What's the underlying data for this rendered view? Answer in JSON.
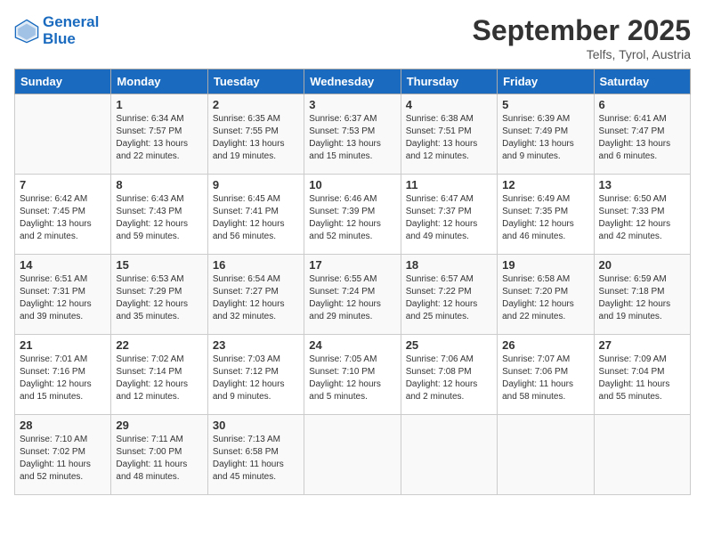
{
  "header": {
    "logo_line1": "General",
    "logo_line2": "Blue",
    "month_title": "September 2025",
    "subtitle": "Telfs, Tyrol, Austria"
  },
  "days_of_week": [
    "Sunday",
    "Monday",
    "Tuesday",
    "Wednesday",
    "Thursday",
    "Friday",
    "Saturday"
  ],
  "weeks": [
    [
      {
        "num": "",
        "sunrise": "",
        "sunset": "",
        "daylight": ""
      },
      {
        "num": "1",
        "sunrise": "Sunrise: 6:34 AM",
        "sunset": "Sunset: 7:57 PM",
        "daylight": "Daylight: 13 hours and 22 minutes."
      },
      {
        "num": "2",
        "sunrise": "Sunrise: 6:35 AM",
        "sunset": "Sunset: 7:55 PM",
        "daylight": "Daylight: 13 hours and 19 minutes."
      },
      {
        "num": "3",
        "sunrise": "Sunrise: 6:37 AM",
        "sunset": "Sunset: 7:53 PM",
        "daylight": "Daylight: 13 hours and 15 minutes."
      },
      {
        "num": "4",
        "sunrise": "Sunrise: 6:38 AM",
        "sunset": "Sunset: 7:51 PM",
        "daylight": "Daylight: 13 hours and 12 minutes."
      },
      {
        "num": "5",
        "sunrise": "Sunrise: 6:39 AM",
        "sunset": "Sunset: 7:49 PM",
        "daylight": "Daylight: 13 hours and 9 minutes."
      },
      {
        "num": "6",
        "sunrise": "Sunrise: 6:41 AM",
        "sunset": "Sunset: 7:47 PM",
        "daylight": "Daylight: 13 hours and 6 minutes."
      }
    ],
    [
      {
        "num": "7",
        "sunrise": "Sunrise: 6:42 AM",
        "sunset": "Sunset: 7:45 PM",
        "daylight": "Daylight: 13 hours and 2 minutes."
      },
      {
        "num": "8",
        "sunrise": "Sunrise: 6:43 AM",
        "sunset": "Sunset: 7:43 PM",
        "daylight": "Daylight: 12 hours and 59 minutes."
      },
      {
        "num": "9",
        "sunrise": "Sunrise: 6:45 AM",
        "sunset": "Sunset: 7:41 PM",
        "daylight": "Daylight: 12 hours and 56 minutes."
      },
      {
        "num": "10",
        "sunrise": "Sunrise: 6:46 AM",
        "sunset": "Sunset: 7:39 PM",
        "daylight": "Daylight: 12 hours and 52 minutes."
      },
      {
        "num": "11",
        "sunrise": "Sunrise: 6:47 AM",
        "sunset": "Sunset: 7:37 PM",
        "daylight": "Daylight: 12 hours and 49 minutes."
      },
      {
        "num": "12",
        "sunrise": "Sunrise: 6:49 AM",
        "sunset": "Sunset: 7:35 PM",
        "daylight": "Daylight: 12 hours and 46 minutes."
      },
      {
        "num": "13",
        "sunrise": "Sunrise: 6:50 AM",
        "sunset": "Sunset: 7:33 PM",
        "daylight": "Daylight: 12 hours and 42 minutes."
      }
    ],
    [
      {
        "num": "14",
        "sunrise": "Sunrise: 6:51 AM",
        "sunset": "Sunset: 7:31 PM",
        "daylight": "Daylight: 12 hours and 39 minutes."
      },
      {
        "num": "15",
        "sunrise": "Sunrise: 6:53 AM",
        "sunset": "Sunset: 7:29 PM",
        "daylight": "Daylight: 12 hours and 35 minutes."
      },
      {
        "num": "16",
        "sunrise": "Sunrise: 6:54 AM",
        "sunset": "Sunset: 7:27 PM",
        "daylight": "Daylight: 12 hours and 32 minutes."
      },
      {
        "num": "17",
        "sunrise": "Sunrise: 6:55 AM",
        "sunset": "Sunset: 7:24 PM",
        "daylight": "Daylight: 12 hours and 29 minutes."
      },
      {
        "num": "18",
        "sunrise": "Sunrise: 6:57 AM",
        "sunset": "Sunset: 7:22 PM",
        "daylight": "Daylight: 12 hours and 25 minutes."
      },
      {
        "num": "19",
        "sunrise": "Sunrise: 6:58 AM",
        "sunset": "Sunset: 7:20 PM",
        "daylight": "Daylight: 12 hours and 22 minutes."
      },
      {
        "num": "20",
        "sunrise": "Sunrise: 6:59 AM",
        "sunset": "Sunset: 7:18 PM",
        "daylight": "Daylight: 12 hours and 19 minutes."
      }
    ],
    [
      {
        "num": "21",
        "sunrise": "Sunrise: 7:01 AM",
        "sunset": "Sunset: 7:16 PM",
        "daylight": "Daylight: 12 hours and 15 minutes."
      },
      {
        "num": "22",
        "sunrise": "Sunrise: 7:02 AM",
        "sunset": "Sunset: 7:14 PM",
        "daylight": "Daylight: 12 hours and 12 minutes."
      },
      {
        "num": "23",
        "sunrise": "Sunrise: 7:03 AM",
        "sunset": "Sunset: 7:12 PM",
        "daylight": "Daylight: 12 hours and 9 minutes."
      },
      {
        "num": "24",
        "sunrise": "Sunrise: 7:05 AM",
        "sunset": "Sunset: 7:10 PM",
        "daylight": "Daylight: 12 hours and 5 minutes."
      },
      {
        "num": "25",
        "sunrise": "Sunrise: 7:06 AM",
        "sunset": "Sunset: 7:08 PM",
        "daylight": "Daylight: 12 hours and 2 minutes."
      },
      {
        "num": "26",
        "sunrise": "Sunrise: 7:07 AM",
        "sunset": "Sunset: 7:06 PM",
        "daylight": "Daylight: 11 hours and 58 minutes."
      },
      {
        "num": "27",
        "sunrise": "Sunrise: 7:09 AM",
        "sunset": "Sunset: 7:04 PM",
        "daylight": "Daylight: 11 hours and 55 minutes."
      }
    ],
    [
      {
        "num": "28",
        "sunrise": "Sunrise: 7:10 AM",
        "sunset": "Sunset: 7:02 PM",
        "daylight": "Daylight: 11 hours and 52 minutes."
      },
      {
        "num": "29",
        "sunrise": "Sunrise: 7:11 AM",
        "sunset": "Sunset: 7:00 PM",
        "daylight": "Daylight: 11 hours and 48 minutes."
      },
      {
        "num": "30",
        "sunrise": "Sunrise: 7:13 AM",
        "sunset": "Sunset: 6:58 PM",
        "daylight": "Daylight: 11 hours and 45 minutes."
      },
      {
        "num": "",
        "sunrise": "",
        "sunset": "",
        "daylight": ""
      },
      {
        "num": "",
        "sunrise": "",
        "sunset": "",
        "daylight": ""
      },
      {
        "num": "",
        "sunrise": "",
        "sunset": "",
        "daylight": ""
      },
      {
        "num": "",
        "sunrise": "",
        "sunset": "",
        "daylight": ""
      }
    ]
  ]
}
